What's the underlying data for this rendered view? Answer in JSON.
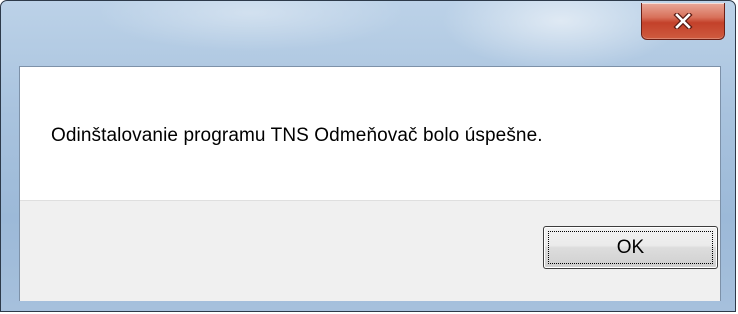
{
  "dialog": {
    "title": "",
    "message": "Odinštalovanie programu TNS Odmeňovač bolo úspešne.",
    "ok_label": "OK"
  },
  "titlebar": {
    "close_icon": "close-icon"
  },
  "colors": {
    "frame": "#a9c3de",
    "close_button": "#c3412a",
    "client_bg": "#ffffff",
    "button_area_bg": "#f0f0f0"
  }
}
